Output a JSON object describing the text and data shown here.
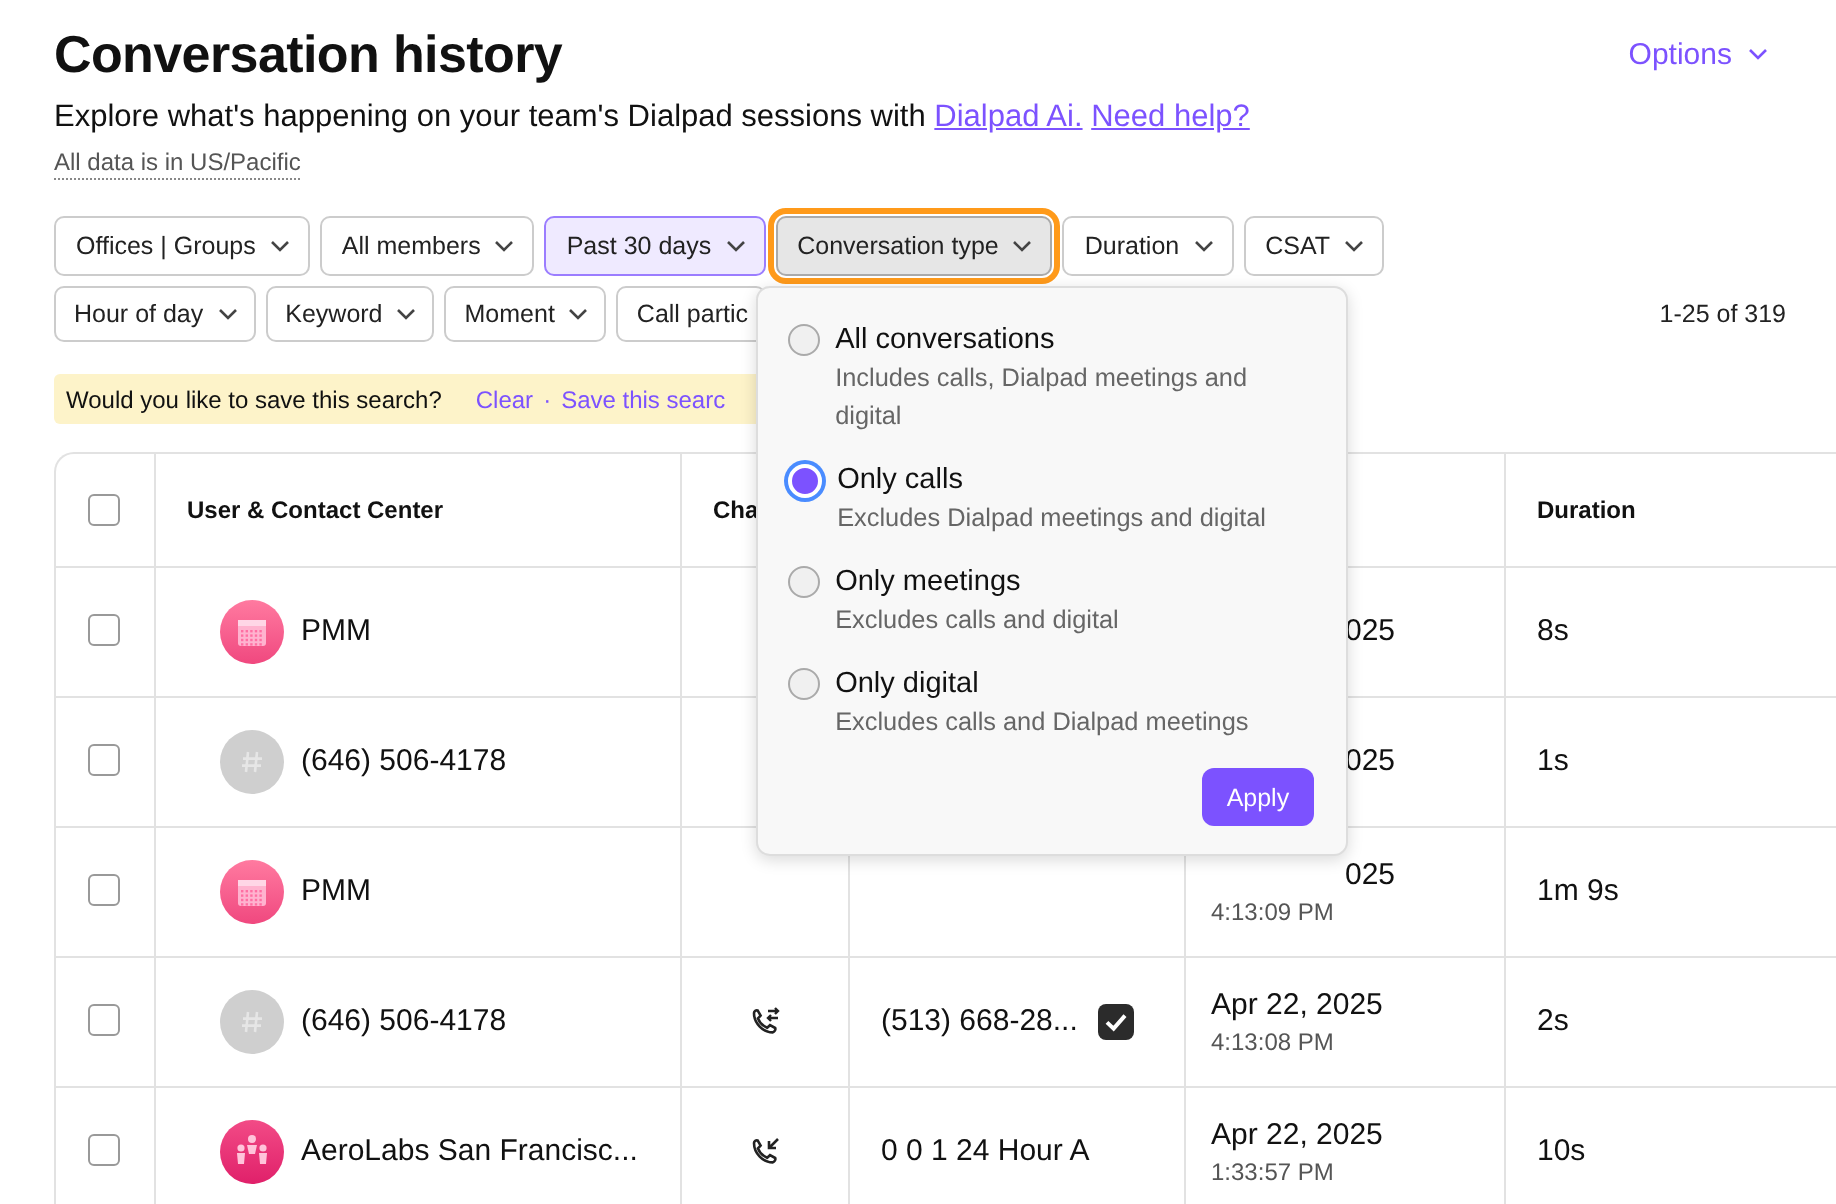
{
  "header": {
    "title": "Conversation history",
    "intro": "Explore what's happening on your team's Dialpad sessions with",
    "links": [
      "Dialpad Ai.",
      "Need help?"
    ],
    "timezone": "All data is in US/Pacific",
    "options": "Options"
  },
  "filter_rows": [
    [
      {
        "label": "Offices | Groups",
        "active": false,
        "open": false,
        "highlighted": false
      },
      {
        "label": "All members",
        "active": false,
        "open": false,
        "highlighted": false
      },
      {
        "label": "Past 30 days",
        "active": true,
        "open": false,
        "highlighted": false
      },
      {
        "label": "Conversation type",
        "active": false,
        "open": true,
        "highlighted": true
      },
      {
        "label": "Duration",
        "active": false,
        "open": false,
        "highlighted": false
      },
      {
        "label": "CSAT",
        "active": false,
        "open": false,
        "highlighted": false
      }
    ],
    [
      {
        "label": "Hour of day",
        "active": false,
        "open": false,
        "highlighted": false
      },
      {
        "label": "Keyword",
        "active": false,
        "open": false,
        "highlighted": false
      },
      {
        "label": "Moment",
        "active": false,
        "open": false,
        "highlighted": false
      },
      {
        "label": "Call partic",
        "active": false,
        "open": false,
        "highlighted": false,
        "cut": true
      }
    ]
  ],
  "result_count": "1-25 of 319",
  "save_banner": {
    "question": "Would you like to save this search?",
    "clear": "Clear",
    "separator": "·",
    "save": "Save this searc"
  },
  "table": {
    "columns": [
      {
        "kind": "checkbox",
        "checked": false
      },
      {
        "kind": "text",
        "label": "User & Contact Center"
      },
      {
        "kind": "text",
        "label": "Cha"
      },
      {
        "kind": "blank"
      },
      {
        "kind": "blank"
      },
      {
        "kind": "text",
        "label": "Duration"
      }
    ],
    "rows": [
      {
        "checked": false,
        "avatar": {
          "kind": "calendar"
        },
        "name": "PMM",
        "date": "025",
        "duration": "8s"
      },
      {
        "checked": false,
        "avatar": {
          "kind": "hash"
        },
        "name": "(646) 506-4178",
        "date": "025",
        "duration": "1s"
      },
      {
        "checked": false,
        "avatar": {
          "kind": "calendar"
        },
        "name": "PMM",
        "date": "025",
        "time": "4:13:09 PM",
        "duration": "1m 9s"
      },
      {
        "checked": false,
        "avatar": {
          "kind": "hash"
        },
        "name": "(646) 506-4178",
        "channel": {
          "kind": "transfer"
        },
        "number": "(513) 668-28...",
        "verified": true,
        "date": "Apr 22, 2025",
        "time": "4:13:08 PM",
        "duration": "2s"
      },
      {
        "checked": false,
        "avatar": {
          "kind": "people"
        },
        "name": "AeroLabs San Francisc...",
        "channel": {
          "kind": "incoming"
        },
        "number": "0 0 1 24 Hour A",
        "verified": false,
        "date": "Apr 22, 2025",
        "time": "1:33:57 PM",
        "duration": "10s"
      }
    ]
  },
  "conversation_type_menu": {
    "options": [
      {
        "label": "All conversations",
        "description": "Includes calls, Dialpad meetings and digital",
        "selected": false
      },
      {
        "label": "Only calls",
        "description": "Excludes Dialpad meetings and digital",
        "selected": true
      },
      {
        "label": "Only meetings",
        "description": "Excludes calls and digital",
        "selected": false
      },
      {
        "label": "Only digital",
        "description": "Excludes calls and Dialpad meetings",
        "selected": false
      }
    ],
    "apply": "Apply"
  }
}
